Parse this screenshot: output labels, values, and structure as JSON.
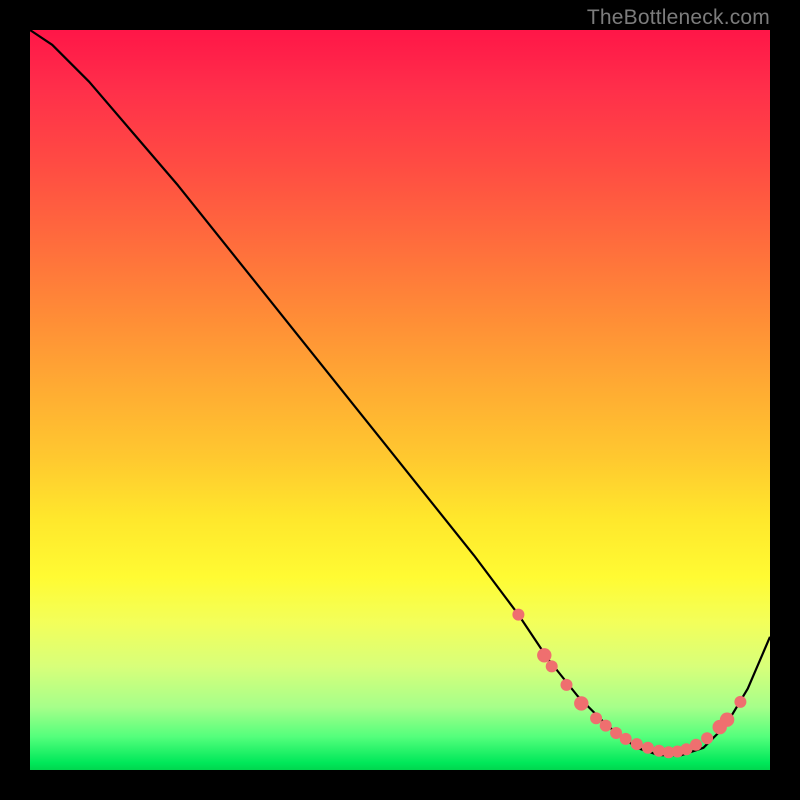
{
  "watermark": "TheBottleneck.com",
  "chart_data": {
    "type": "line",
    "title": "",
    "xlabel": "",
    "ylabel": "",
    "xlim": [
      0,
      100
    ],
    "ylim": [
      0,
      100
    ],
    "grid": false,
    "legend": false,
    "background": "rainbow-gradient-vertical",
    "series": [
      {
        "name": "curve",
        "color": "#000000",
        "x": [
          0,
          3,
          8,
          14,
          20,
          28,
          36,
          44,
          52,
          60,
          66,
          70,
          74,
          78,
          82,
          85,
          88,
          91,
          94,
          97,
          100
        ],
        "y": [
          100,
          98,
          93,
          86,
          79,
          69,
          59,
          49,
          39,
          29,
          21,
          15,
          10,
          6,
          3,
          2,
          2,
          3,
          6,
          11,
          18
        ]
      }
    ],
    "highlight_points": {
      "color": "#ef6f6f",
      "points": [
        {
          "x": 66.0,
          "y": 21.0,
          "r": 1.0
        },
        {
          "x": 69.5,
          "y": 15.5,
          "r": 1.2
        },
        {
          "x": 70.5,
          "y": 14.0,
          "r": 1.0
        },
        {
          "x": 72.5,
          "y": 11.5,
          "r": 1.0
        },
        {
          "x": 74.5,
          "y": 9.0,
          "r": 1.2
        },
        {
          "x": 76.5,
          "y": 7.0,
          "r": 1.0
        },
        {
          "x": 77.8,
          "y": 6.0,
          "r": 1.0
        },
        {
          "x": 79.2,
          "y": 5.0,
          "r": 1.0
        },
        {
          "x": 80.5,
          "y": 4.2,
          "r": 1.0
        },
        {
          "x": 82.0,
          "y": 3.5,
          "r": 1.0
        },
        {
          "x": 83.5,
          "y": 3.0,
          "r": 1.0
        },
        {
          "x": 85.0,
          "y": 2.6,
          "r": 1.0
        },
        {
          "x": 86.3,
          "y": 2.4,
          "r": 1.0
        },
        {
          "x": 87.5,
          "y": 2.5,
          "r": 1.0
        },
        {
          "x": 88.7,
          "y": 2.8,
          "r": 1.0
        },
        {
          "x": 90.0,
          "y": 3.4,
          "r": 1.0
        },
        {
          "x": 91.5,
          "y": 4.3,
          "r": 1.0
        },
        {
          "x": 93.2,
          "y": 5.8,
          "r": 1.2
        },
        {
          "x": 94.2,
          "y": 6.8,
          "r": 1.2
        },
        {
          "x": 96.0,
          "y": 9.2,
          "r": 1.0
        }
      ]
    }
  }
}
